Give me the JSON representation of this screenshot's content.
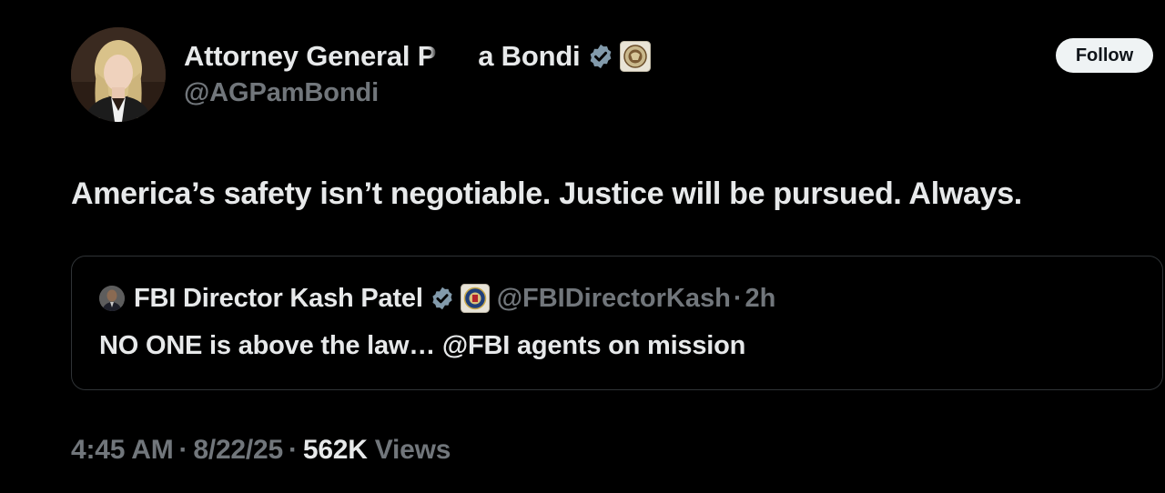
{
  "author": {
    "display_name_start": "Attorney General P",
    "display_name_end": "a Bondi",
    "handle": "@AGPamBondi",
    "verified_icon": "verified-badge-icon",
    "affiliation_icon": "doj-seal-icon"
  },
  "follow_label": "Follow",
  "tweet_text": "America’s safety isn’t negotiable. Justice will be pursued. Always.",
  "quote": {
    "display_name": "FBI Director Kash Patel",
    "handle": "@FBIDirectorKash",
    "separator": "·",
    "time": "2h",
    "text": "NO ONE is above the law… @FBI agents on mission",
    "verified_icon": "verified-badge-icon",
    "affiliation_icon": "fbi-seal-icon"
  },
  "meta": {
    "time": "4:45 AM",
    "separator": "·",
    "date": "8/22/25",
    "views_count": "562K",
    "views_label": "Views"
  },
  "colors": {
    "background": "#000000",
    "primary_text": "#e7e9ea",
    "secondary_text": "#71767b",
    "border": "#2f3336",
    "verified_badge": "#829aab",
    "follow_button_bg": "#eff3f4"
  }
}
